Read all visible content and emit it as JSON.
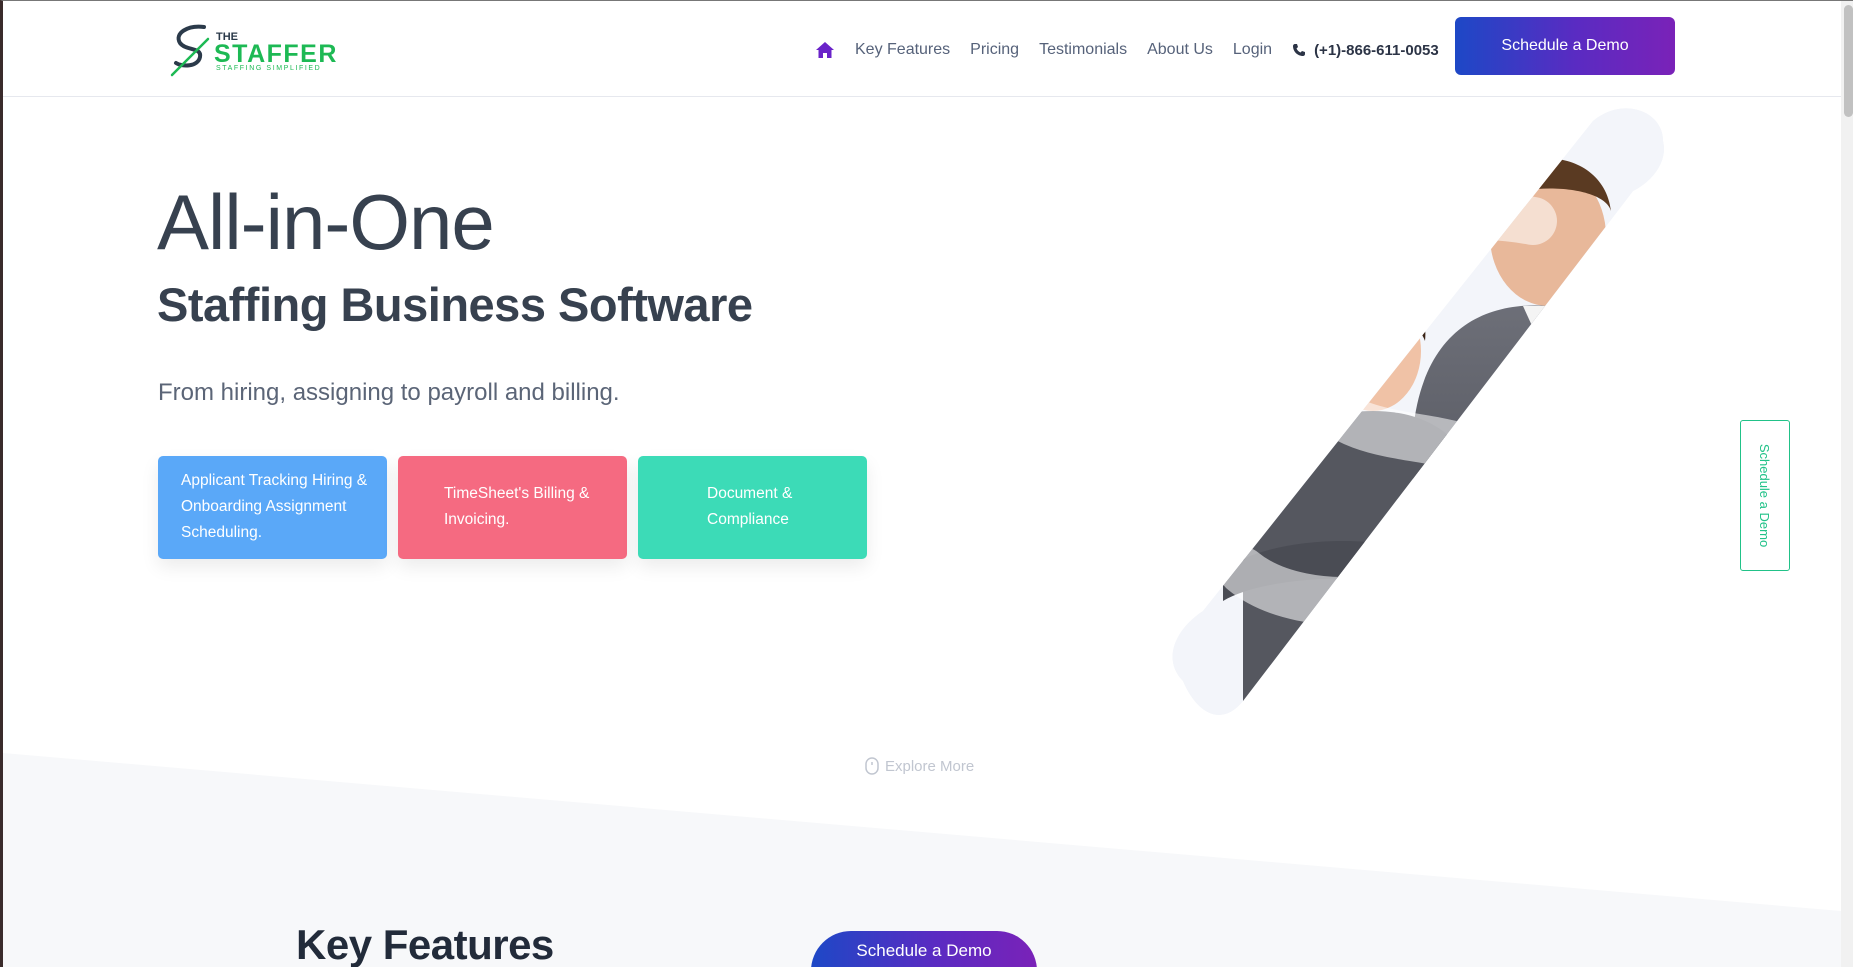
{
  "header": {
    "logo": {
      "line1": "THE",
      "line2": "STAFFER",
      "tagline": "STAFFING SIMPLIFIED"
    },
    "nav": [
      "Key Features",
      "Pricing",
      "Testimonials",
      "About Us",
      "Login"
    ],
    "phone": "(+1)-866-611-0053",
    "cta": "Schedule a Demo"
  },
  "hero": {
    "title_line1": "All-in-One",
    "title_line2": "Staffing Business Software",
    "subtitle": "From hiring, assigning to payroll and billing.",
    "cards": [
      {
        "lines": [
          "Applicant Tracking Hiring &",
          "Onboarding Assignment",
          "Scheduling."
        ],
        "color": "#5aa8f8"
      },
      {
        "lines": [
          "TimeSheet's Billing &",
          "Invoicing."
        ],
        "color": "#f56a81"
      },
      {
        "lines": [
          "Document &",
          "Compliance"
        ],
        "color": "#3cdbb7"
      }
    ]
  },
  "side_tab": "Schedule a Demo",
  "explore": "Explore More",
  "section": {
    "title": "Key Features"
  },
  "floating_cta": "Schedule a Demo",
  "colors": {
    "brand_green": "#1db954",
    "cta_gradient_start": "#1d48c6",
    "cta_gradient_end": "#7a22b8",
    "text_dark": "#37414f"
  },
  "icons": [
    "home-icon",
    "phone-icon",
    "mouse-icon",
    "logo-s-icon"
  ]
}
